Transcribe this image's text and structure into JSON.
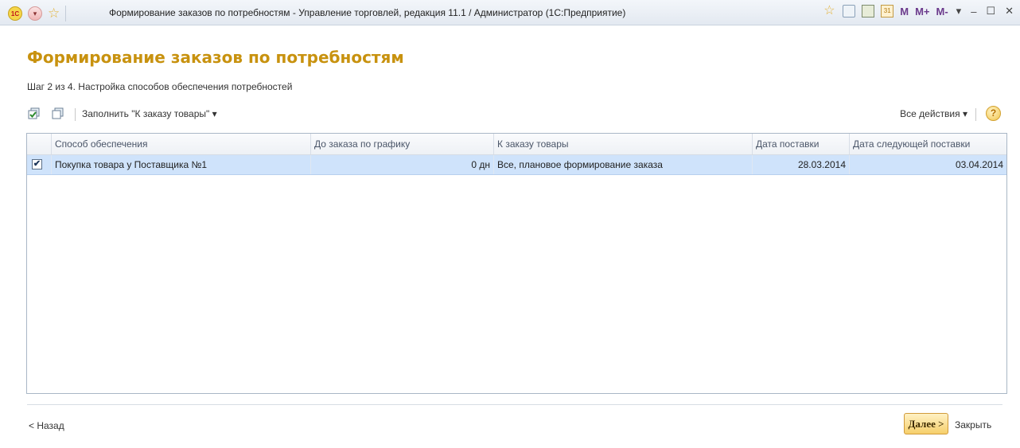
{
  "titlebar": {
    "logo_text": "1С",
    "title": "Формирование заказов по потребностям - Управление торговлей, редакция 11.1 / Администратор  (1С:Предприятие)",
    "memory_buttons": [
      "M",
      "M+",
      "M-"
    ]
  },
  "form": {
    "title": "Формирование заказов по потребностям",
    "step": "Шаг 2 из 4. Настройка способов обеспечения потребностей"
  },
  "toolbar": {
    "fill_label": "Заполнить \"К заказу товары\" ▾",
    "all_actions_label": "Все действия ▾",
    "help_label": "?"
  },
  "table": {
    "columns": [
      "Способ обеспечения",
      "До заказа по графику",
      "К заказу товары",
      "Дата поставки",
      "Дата следующей поставки"
    ],
    "rows": [
      {
        "checked": true,
        "method": "Покупка товара у Поставщика №1",
        "until_order": "0 дн",
        "to_order": "Все, плановое формирование заказа",
        "delivery_date": "28.03.2014",
        "next_delivery_date": "03.04.2014"
      }
    ]
  },
  "footer": {
    "back_label": "< Назад",
    "next_label": "Далее >",
    "close_label": "Закрыть"
  },
  "colors": {
    "title": "#c8920f",
    "selected_row": "#cfe3fb",
    "next_button": "#f6cf6b"
  }
}
